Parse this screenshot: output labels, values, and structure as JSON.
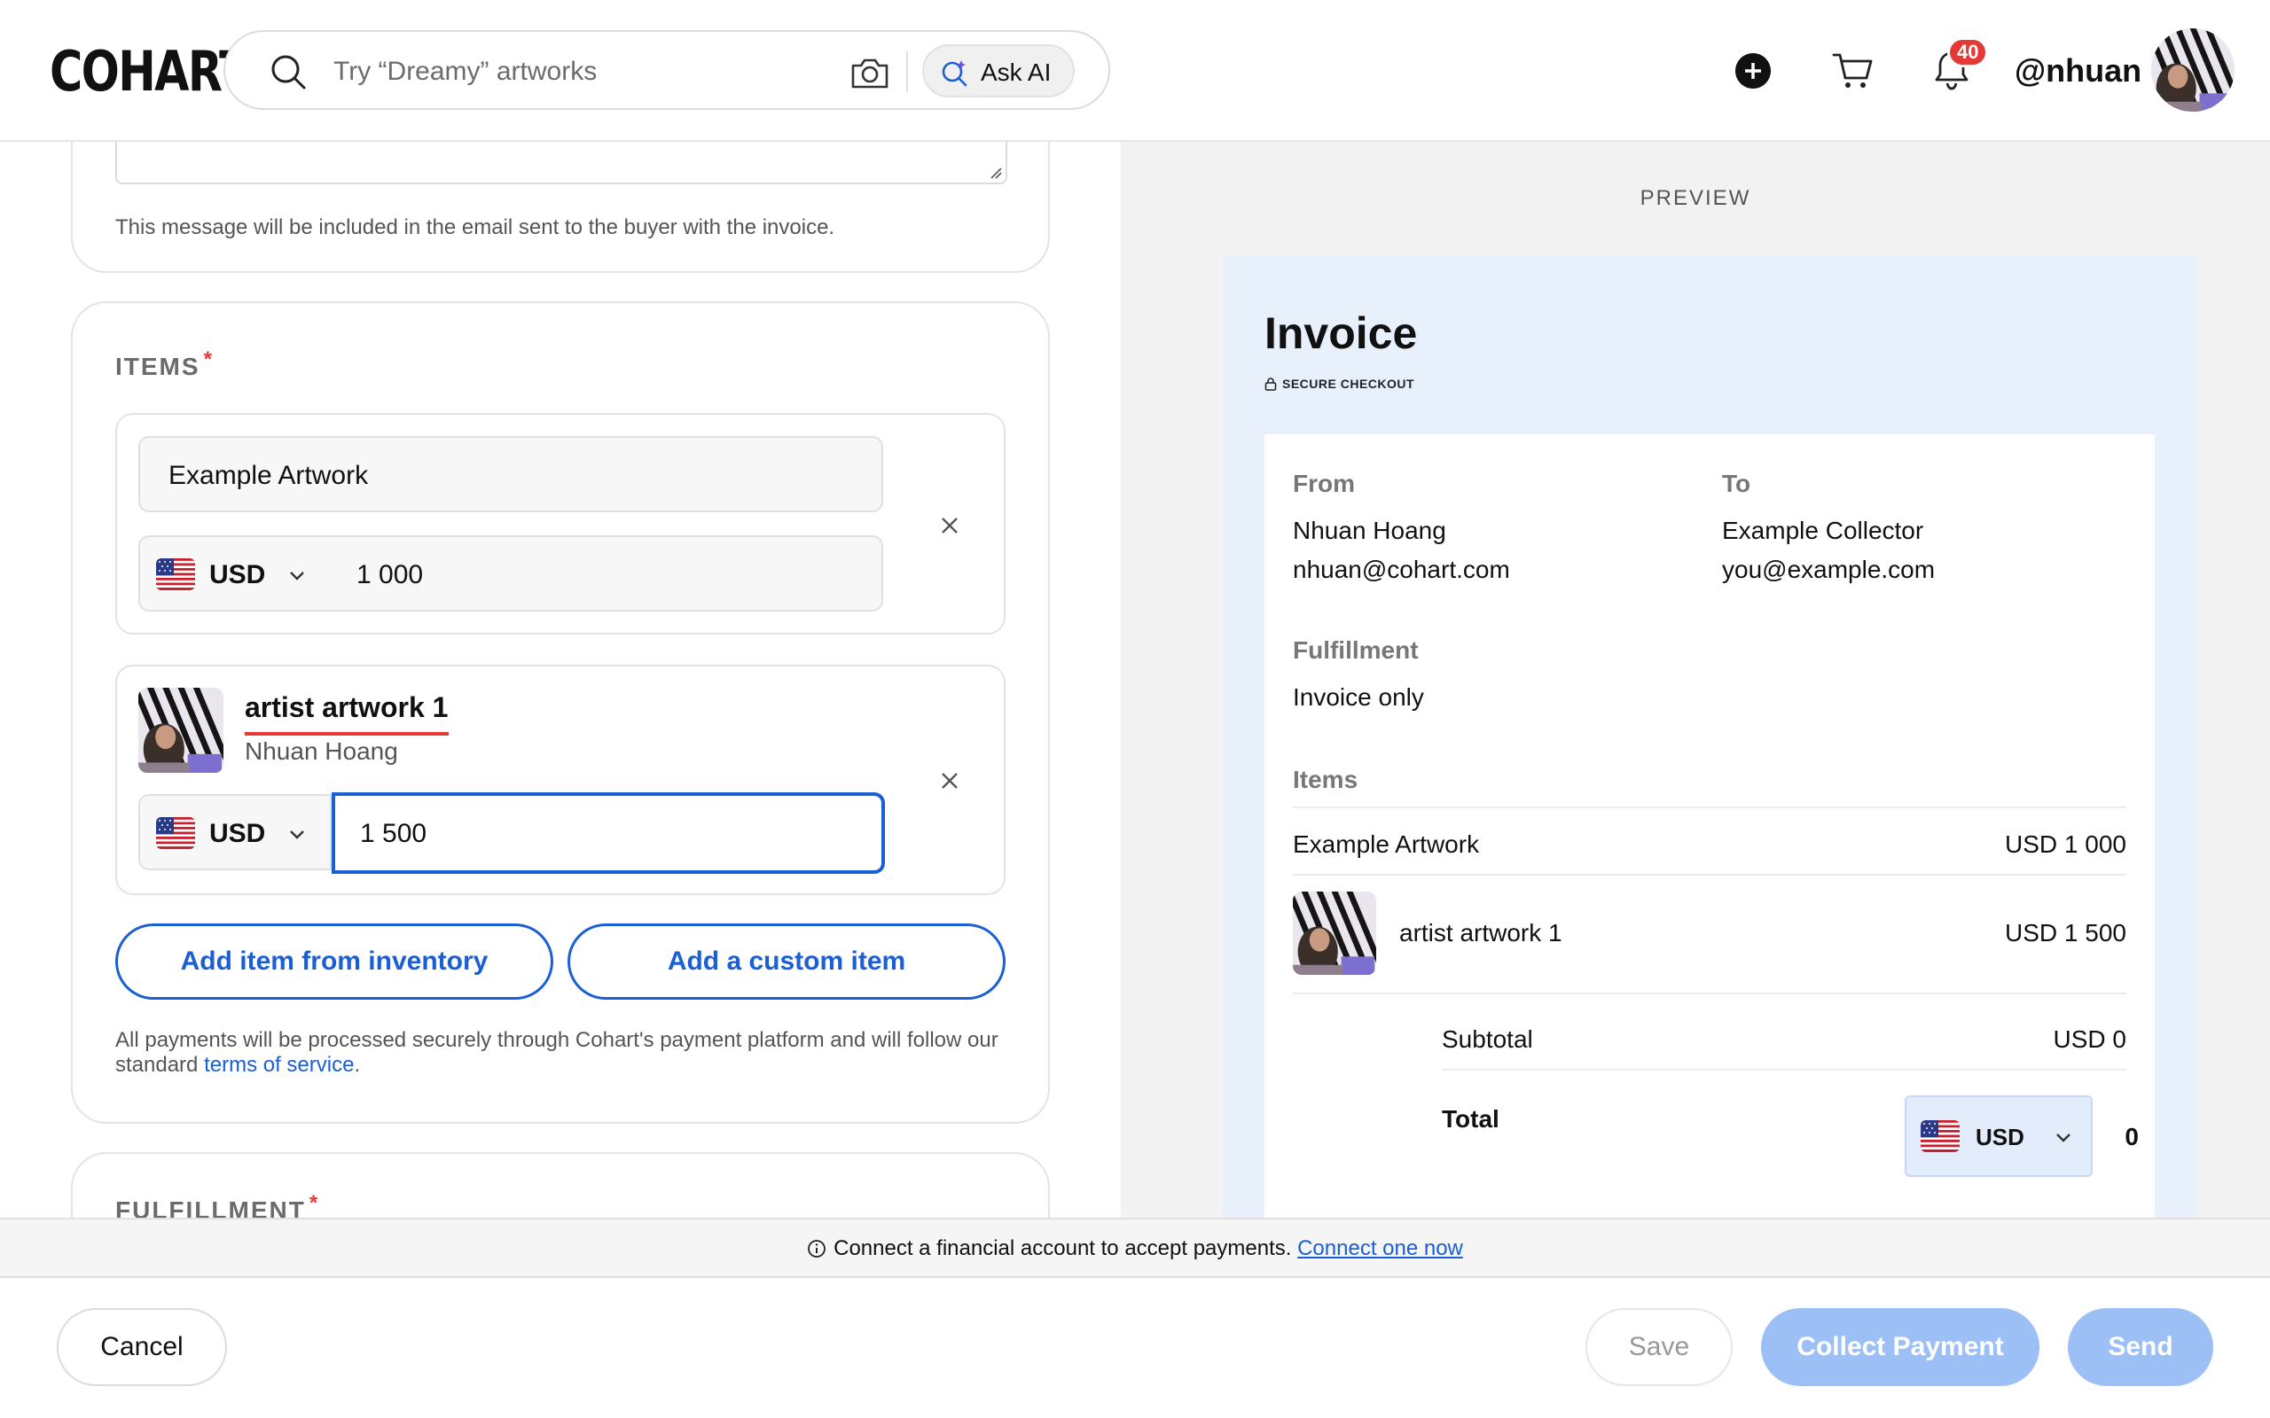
{
  "header": {
    "logo": "COHART",
    "search_placeholder": "Try “Dreamy” artworks",
    "ask_ai_label": "Ask AI",
    "notification_count": "40",
    "username": "@nhuan"
  },
  "message_section": {
    "hint": "This message will be included in the email sent to the buyer with the invoice."
  },
  "items_section": {
    "title": "ITEMS",
    "required_mark": "*",
    "items": [
      {
        "name": "Example Artwork",
        "currency": "USD",
        "amount": "1 000"
      },
      {
        "title": "artist artwork 1",
        "artist": "Nhuan Hoang",
        "currency": "USD",
        "amount": "1 500"
      }
    ],
    "add_inventory_label": "Add item from inventory",
    "add_custom_label": "Add a custom item",
    "payment_note": "All payments will be processed securely through Cohart's payment platform and will follow our standard ",
    "terms_link": "terms of service",
    "payment_note_end": "."
  },
  "fulfillment_section": {
    "title": "FULFILLMENT",
    "required_mark": "*"
  },
  "preview": {
    "label": "PREVIEW",
    "invoice_title": "Invoice",
    "secure_label": "SECURE CHECKOUT",
    "from_label": "From",
    "from_name": "Nhuan Hoang",
    "from_email": "nhuan@cohart.com",
    "to_label": "To",
    "to_name": "Example Collector",
    "to_email": "you@example.com",
    "fulfillment_label": "Fulfillment",
    "fulfillment_value": "Invoice only",
    "items_label": "Items",
    "line_items": [
      {
        "name": "Example Artwork",
        "price": "USD 1 000"
      },
      {
        "name": "artist artwork 1",
        "price": "USD 1 500"
      }
    ],
    "subtotal_label": "Subtotal",
    "subtotal_value": "USD 0",
    "total_label": "Total",
    "total_currency": "USD",
    "total_value": "0"
  },
  "notice": {
    "text": "Connect a financial account to accept payments.",
    "link": "Connect one now"
  },
  "footer": {
    "cancel_label": "Cancel",
    "save_label": "Save",
    "collect_label": "Collect Payment",
    "send_label": "Send"
  },
  "colors": {
    "accent": "#1a5fd6",
    "badge": "#e53935",
    "preview_bg": "#e8f0fc",
    "disabled_primary": "#9cc0f6"
  },
  "icons": [
    "search-icon",
    "camera-icon",
    "sparkle-search-icon",
    "plus-circle-icon",
    "cart-icon",
    "bell-icon",
    "close-icon",
    "chevron-down-icon",
    "us-flag-icon",
    "lock-icon",
    "info-icon"
  ]
}
